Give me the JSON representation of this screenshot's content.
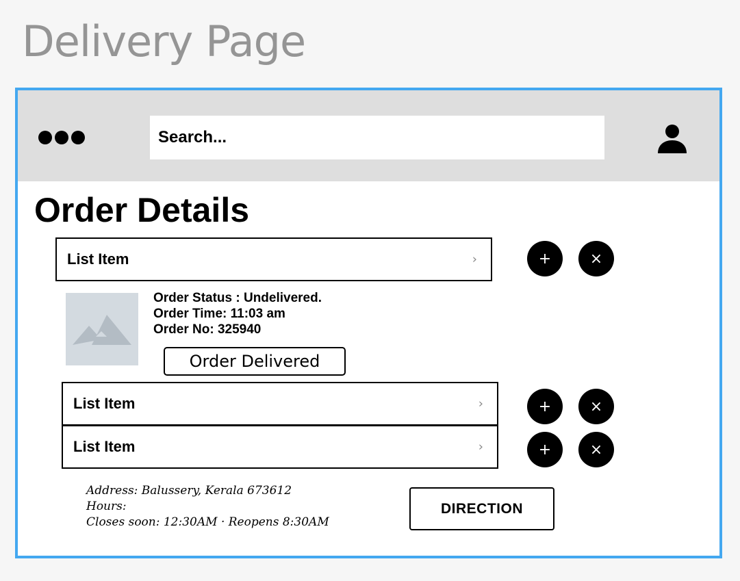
{
  "page": {
    "title": "Delivery Page"
  },
  "header": {
    "menu_icon": "more-dots-icon",
    "search_placeholder": "Search...",
    "user_icon": "user-icon"
  },
  "main": {
    "heading": "Order Details",
    "list_items": [
      {
        "label": "List Item",
        "chevron": "›",
        "add_icon": "+",
        "remove_icon": "×"
      },
      {
        "label": "List Item",
        "chevron": "›",
        "add_icon": "+",
        "remove_icon": "×"
      },
      {
        "label": "List Item",
        "chevron": "›",
        "add_icon": "+",
        "remove_icon": "×"
      }
    ],
    "order": {
      "image_icon": "image-placeholder-icon",
      "status": "Order Status : Undelivered.",
      "time": "Order Time: 11:03 am",
      "number": "Order No: 325940",
      "delivered_button": "Order Delivered"
    },
    "location": {
      "address": "Address: Balussery, Kerala 673612",
      "hours_label": "Hours:",
      "hours": "Closes soon: 12:30AM · Reopens 8:30AM",
      "direction_button": "DIRECTION"
    }
  },
  "colors": {
    "frame_border": "#44a8f0",
    "topbar_bg": "#dedede",
    "placeholder_image": "#d3dae0"
  }
}
